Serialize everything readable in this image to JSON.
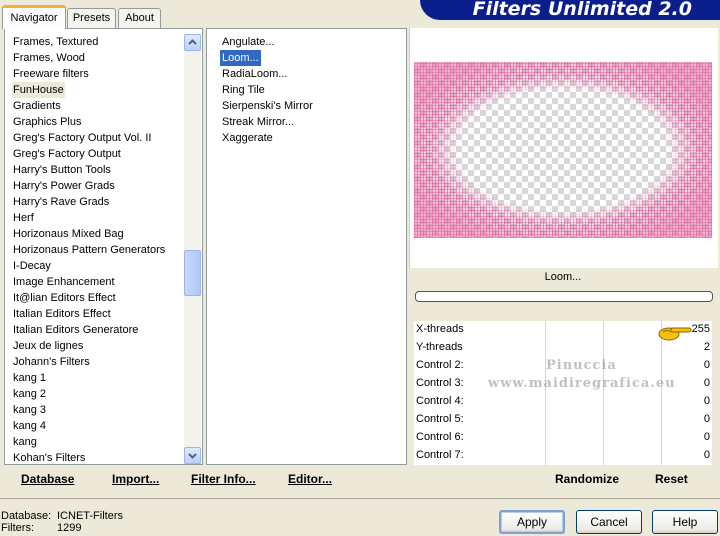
{
  "app": {
    "title": "Filters Unlimited 2.0"
  },
  "tabs": [
    {
      "label": "Navigator",
      "active": true
    },
    {
      "label": "Presets",
      "active": false
    },
    {
      "label": "About",
      "active": false
    }
  ],
  "categories": [
    "Frames, Textured",
    "Frames, Wood",
    "Freeware filters",
    "FunHouse",
    "Gradients",
    "Graphics Plus",
    "Greg's Factory Output Vol. II",
    "Greg's Factory Output",
    "Harry's Button Tools",
    "Harry's Power Grads",
    "Harry's Rave Grads",
    "Herf",
    "Horizonaus Mixed Bag",
    "Horizonaus Pattern Generators",
    "I-Decay",
    "Image Enhancement",
    "It@lian Editors Effect",
    "Italian Editors Effect",
    "Italian Editors Generatore",
    "Jeux de lignes",
    "Johann's Filters",
    "kang 1",
    "kang 2",
    "kang 3",
    "kang 4",
    "kang",
    "Kohan's Filters"
  ],
  "selected_category": "FunHouse",
  "filters": [
    "Angulate...",
    "Loom...",
    "RadiaLoom...",
    "Ring Tile",
    "Sierpenski's Mirror",
    "Streak Mirror...",
    "Xaggerate"
  ],
  "selected_filter": "Loom...",
  "preview": {
    "filter_label": "Loom...",
    "progress": 0
  },
  "controls": [
    {
      "label": "X-threads",
      "value": "255"
    },
    {
      "label": "Y-threads",
      "value": "2"
    },
    {
      "label": "Control 2:",
      "value": "0"
    },
    {
      "label": "Control 3:",
      "value": "0"
    },
    {
      "label": "Control 4:",
      "value": "0"
    },
    {
      "label": "Control 5:",
      "value": "0"
    },
    {
      "label": "Control 6:",
      "value": "0"
    },
    {
      "label": "Control 7:",
      "value": "0"
    }
  ],
  "watermark": {
    "line1": "Pinuccia",
    "line2": "www.maidiregrafica.eu"
  },
  "toolbar": {
    "database": "Database",
    "import": "Import...",
    "filter_info": "Filter Info...",
    "editor": "Editor...",
    "randomize": "Randomize",
    "reset": "Reset"
  },
  "status": {
    "database_label": "Database:",
    "database_value": "ICNET-Filters",
    "filters_label": "Filters:",
    "filters_value": "1299"
  },
  "buttons": {
    "apply": "Apply",
    "cancel": "Cancel",
    "help": "Help"
  },
  "colors": {
    "banner": "#0a1e8c",
    "selection": "#316ac5",
    "tab_accent": "#f7b12f"
  }
}
